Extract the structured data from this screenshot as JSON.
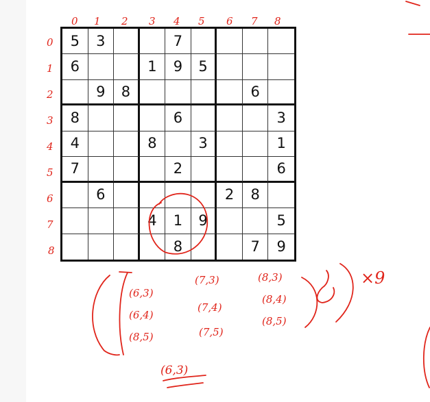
{
  "sudoku": {
    "rows": [
      [
        "5",
        "3",
        "",
        "",
        "7",
        "",
        "",
        "",
        ""
      ],
      [
        "6",
        "",
        "",
        "1",
        "9",
        "5",
        "",
        "",
        ""
      ],
      [
        "",
        "9",
        "8",
        "",
        "",
        "",
        "",
        "6",
        ""
      ],
      [
        "8",
        "",
        "",
        "",
        "6",
        "",
        "",
        "",
        "3"
      ],
      [
        "4",
        "",
        "",
        "8",
        "",
        "3",
        "",
        "",
        "1"
      ],
      [
        "7",
        "",
        "",
        "",
        "2",
        "",
        "",
        "",
        "6"
      ],
      [
        "",
        "6",
        "",
        "",
        "",
        "",
        "2",
        "8",
        ""
      ],
      [
        "",
        "",
        "",
        "4",
        "1",
        "9",
        "",
        "",
        "5"
      ],
      [
        "",
        "",
        "",
        "",
        "8",
        "",
        "",
        "7",
        "9"
      ]
    ]
  },
  "annotations": {
    "ink_color": "#e0241a",
    "column_labels": [
      "0",
      "1",
      "2",
      "3",
      "4",
      "5",
      "6",
      "7",
      "8"
    ],
    "row_labels": [
      "0",
      "1",
      "2",
      "3",
      "4",
      "5",
      "6",
      "7",
      "8"
    ],
    "coordinates": [
      [
        "(6,3)",
        "(7,3)",
        "(8,3)"
      ],
      [
        "(6,4)",
        "(7,4)",
        "(8,4)"
      ],
      [
        "(8,5)",
        "(7,5)",
        "(8,5)"
      ]
    ],
    "multiplier": "×9",
    "bottom_note": "(6,3)"
  }
}
